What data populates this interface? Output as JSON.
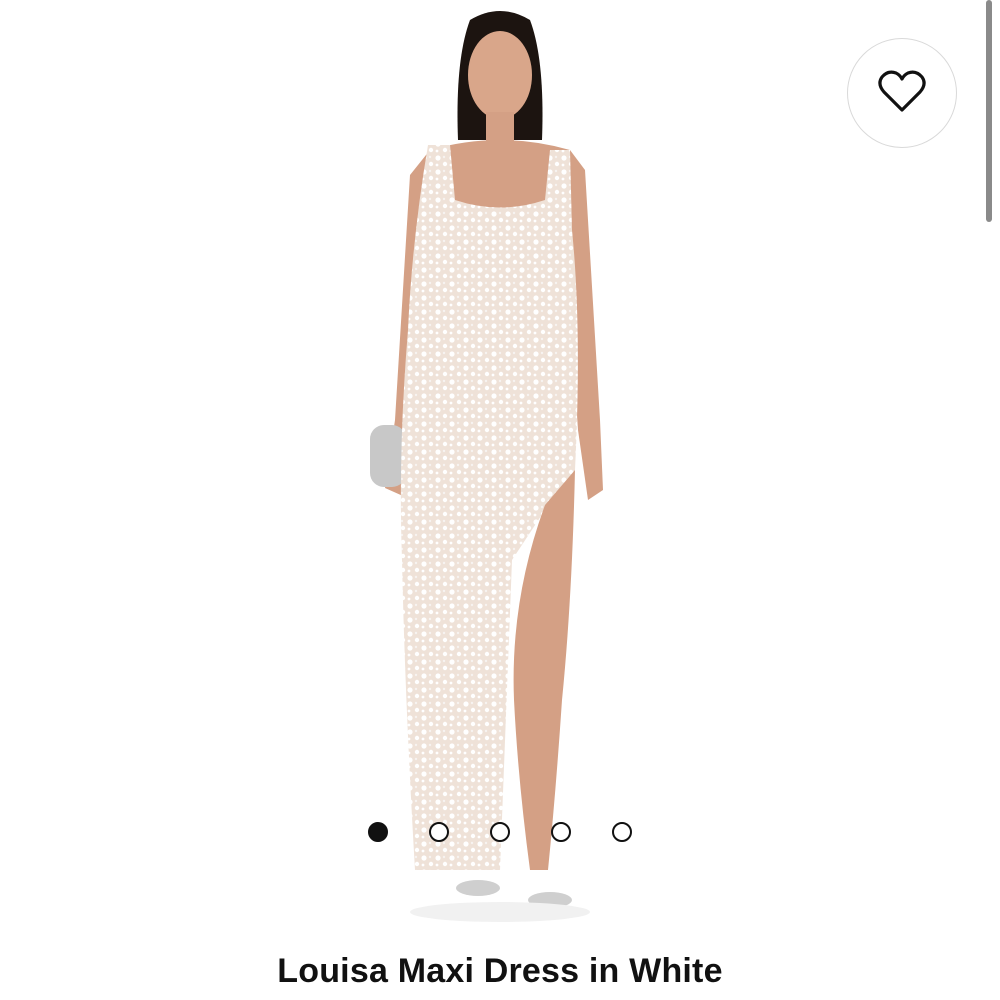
{
  "product": {
    "title": "Louisa Maxi Dress in White",
    "image_alt": "model wearing white sequin lace maxi dress with high slit"
  },
  "wishlist": {
    "icon": "heart-icon"
  },
  "carousel": {
    "count": 5,
    "active_index": 0
  },
  "colors": {
    "dot": "#111111",
    "background": "#ffffff"
  }
}
